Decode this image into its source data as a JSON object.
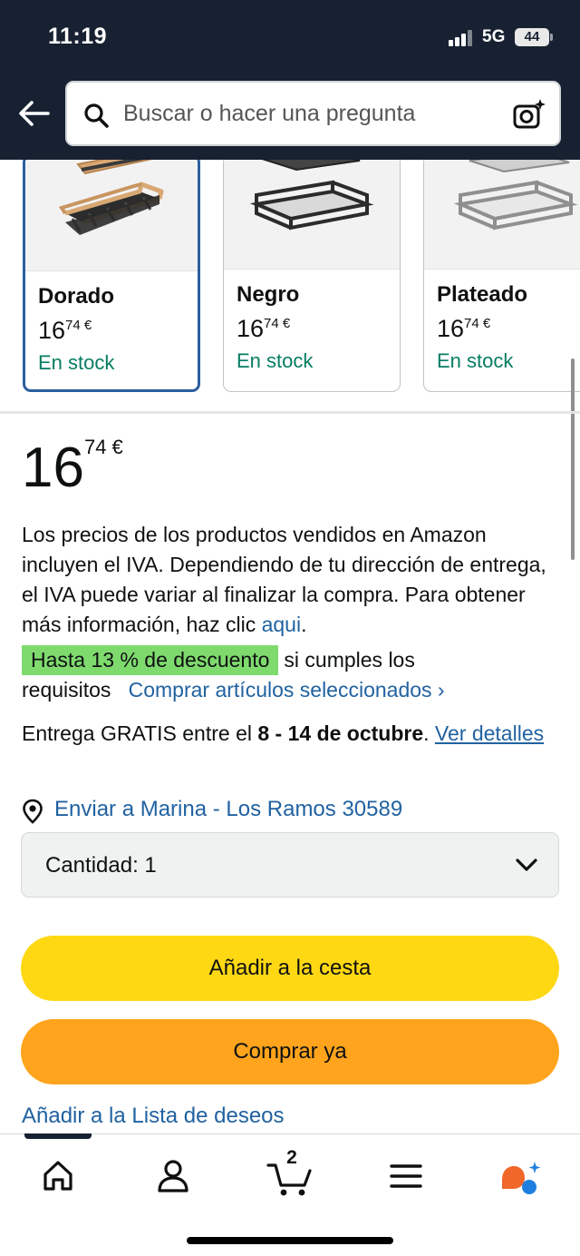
{
  "status_bar": {
    "time": "11:19",
    "network": "5G",
    "battery": "44"
  },
  "search": {
    "placeholder": "Buscar o hacer una pregunta"
  },
  "variants": [
    {
      "name": "Dorado",
      "price_whole": "16",
      "price_fraction": "74 €",
      "stock": "En stock",
      "selected": true
    },
    {
      "name": "Negro",
      "price_whole": "16",
      "price_fraction": "74 €",
      "stock": "En stock",
      "selected": false
    },
    {
      "name": "Plateado",
      "price_whole": "16",
      "price_fraction": "74 €",
      "stock": "En stock",
      "selected": false
    }
  ],
  "price": {
    "whole": "16",
    "fraction": "74 €"
  },
  "vat_note": {
    "text": "Los precios de los productos vendidos en Amazon incluyen el IVA. Dependiendo de tu dirección de entrega, el IVA puede variar al finalizar la compra. Para obtener más información, haz clic ",
    "link": "aqui",
    "end": "."
  },
  "discount": {
    "badge": "Hasta 13 % de descuento",
    "text": "si cumples los requisitos",
    "link": "Comprar artículos seleccionados ›"
  },
  "delivery": {
    "prefix": "Entrega GRATIS entre el ",
    "dates": "8 - 14 de octubre",
    "suffix": ". ",
    "link": "Ver detalles"
  },
  "ship_to": {
    "label": "Enviar a Marina - Los Ramos 30589"
  },
  "quantity": {
    "label": "Cantidad:",
    "value": "1"
  },
  "buttons": {
    "add_to_cart": "Añadir a la cesta",
    "buy_now": "Comprar ya",
    "wishlist": "Añadir a la Lista de deseos"
  },
  "bottom_nav": {
    "cart_count": "2",
    "icons": [
      "home-icon",
      "account-icon",
      "cart-icon",
      "menu-icon",
      "assistant-icon"
    ]
  },
  "colors": {
    "header_bg": "#172131",
    "link": "#2162a1",
    "stock_green": "#067d62",
    "badge_green": "#7fda6e",
    "cart_button": "#ffd814",
    "buy_button": "#ffa41c",
    "selected_border": "#2a5f9e"
  }
}
